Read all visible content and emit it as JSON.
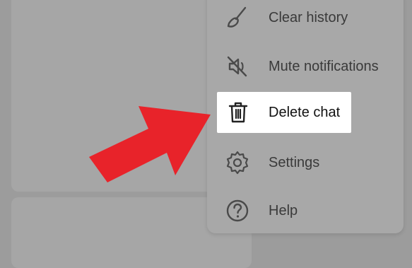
{
  "menu": {
    "items": [
      {
        "label": "Clear history",
        "icon": "broom-icon"
      },
      {
        "label": "Mute notifications",
        "icon": "speaker-muted-icon"
      },
      {
        "label": "Delete chat",
        "icon": "trash-icon",
        "highlighted": true
      },
      {
        "label": "Settings",
        "icon": "gear-icon"
      },
      {
        "label": "Help",
        "icon": "question-circle-icon"
      }
    ]
  },
  "colors": {
    "overlay_gray": "#9c9c9c",
    "menu_gray": "#a8a8a8",
    "highlight_white": "#ffffff",
    "arrow_red": "#e8232a"
  }
}
